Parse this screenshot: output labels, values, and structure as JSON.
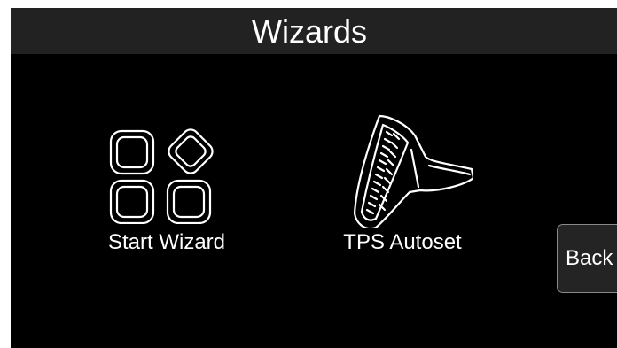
{
  "header": {
    "title": "Wizards"
  },
  "tiles": [
    {
      "label": "Start Wizard",
      "icon": "wizard-grid-icon"
    },
    {
      "label": "TPS Autoset",
      "icon": "throttle-pedal-icon"
    }
  ],
  "back_button": {
    "label": "Back"
  },
  "colors": {
    "background": "#000000",
    "title_bar": "#222222",
    "text": "#ffffff",
    "button_border": "#8a8a8a"
  }
}
